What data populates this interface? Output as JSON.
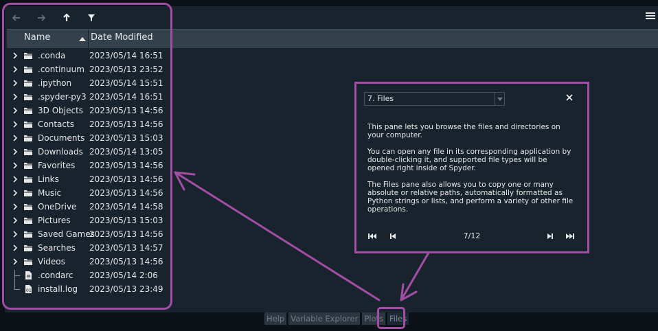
{
  "toolbar": {
    "back_icon": "arrow-left-icon",
    "forward_icon": "arrow-right-icon",
    "up_icon": "arrow-up-icon",
    "filter_icon": "filter-icon",
    "menu_icon": "hamburger-menu-icon"
  },
  "header": {
    "name": "Name",
    "date_modified": "Date Modified"
  },
  "files": [
    {
      "name": ".conda",
      "date": "2023/05/14 16:51",
      "type": "folder"
    },
    {
      "name": ".continuum",
      "date": "2023/05/13 23:52",
      "type": "folder"
    },
    {
      "name": ".ipython",
      "date": "2023/05/14 15:51",
      "type": "folder"
    },
    {
      "name": ".spyder-py3",
      "date": "2023/05/14 16:51",
      "type": "folder"
    },
    {
      "name": "3D Objects",
      "date": "2023/05/13 14:56",
      "type": "folder"
    },
    {
      "name": "Contacts",
      "date": "2023/05/13 14:56",
      "type": "folder"
    },
    {
      "name": "Documents",
      "date": "2023/05/13 15:03",
      "type": "folder"
    },
    {
      "name": "Downloads",
      "date": "2023/05/14 13:05",
      "type": "folder"
    },
    {
      "name": "Favorites",
      "date": "2023/05/13 14:56",
      "type": "folder"
    },
    {
      "name": "Links",
      "date": "2023/05/13 14:56",
      "type": "folder"
    },
    {
      "name": "Music",
      "date": "2023/05/13 14:56",
      "type": "folder"
    },
    {
      "name": "OneDrive",
      "date": "2023/05/14 14:58",
      "type": "folder"
    },
    {
      "name": "Pictures",
      "date": "2023/05/13 15:03",
      "type": "folder"
    },
    {
      "name": "Saved Games",
      "date": "2023/05/13 14:56",
      "type": "folder"
    },
    {
      "name": "Searches",
      "date": "2023/05/13 14:57",
      "type": "folder"
    },
    {
      "name": "Videos",
      "date": "2023/05/13 14:56",
      "type": "folder"
    },
    {
      "name": ".condarc",
      "date": "2023/05/14 2:06",
      "type": "file"
    },
    {
      "name": "install.log",
      "date": "2023/05/13 23:49",
      "type": "log"
    }
  ],
  "tour": {
    "selected": "7. Files",
    "paragraphs": [
      "This pane lets you browse the files and directories on your computer.",
      "You can open any file in its corresponding application by double-clicking it, and supported file types will be opened right inside of Spyder.",
      "The Files pane also allows you to copy one or many absolute or relative paths, automatically formatted as Python strings or lists, and perform a variety of other file operations."
    ],
    "counter": "7/12"
  },
  "tabs": [
    {
      "label": "Help"
    },
    {
      "label": "Variable Explorer"
    },
    {
      "label": "Plots"
    },
    {
      "label": "Files",
      "active": true
    }
  ],
  "colors": {
    "background": "#19232d",
    "header": "#32414b",
    "callout": "#a24ea5"
  }
}
